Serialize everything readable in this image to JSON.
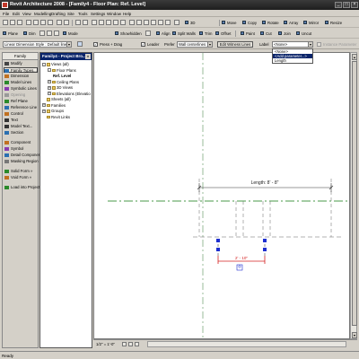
{
  "window": {
    "title": "Revit Architecture 2008 - [Family4 - Floor Plan: Ref. Level]",
    "controls": [
      "_",
      "□",
      "×"
    ]
  },
  "menu": [
    "File",
    "Edit",
    "View",
    "Modelling",
    "Drafting",
    "Site",
    "Tools",
    "Settings",
    "Window",
    "Help"
  ],
  "toolbar_top": {
    "right": [
      "Move",
      "Copy",
      "Rotate",
      "Array",
      "Mirror",
      "Resize"
    ],
    "view_3d": "3D"
  },
  "toolbar_second": {
    "left": [
      "Plane",
      "Dim"
    ],
    "mid": [
      "Mode",
      "Showhidden",
      "Align",
      "Split Walls",
      "Trim",
      "Offset"
    ],
    "right": [
      "Paint",
      "Cut",
      "Join",
      "Uncut"
    ]
  },
  "options_bar": {
    "dimension_style": "Linear Dimension Style : Default linea",
    "prefer_label": "Prefer",
    "prefer_value": "Wall centerlines",
    "press_drag": "Press + Drag",
    "leader": "Leader",
    "edit_witness_lines": "Edit Witness Lines",
    "label_label": "Label",
    "label_value": "<None>",
    "instance_parameter": "Instance Parameter",
    "label_options": [
      "<None>",
      "<Add parameter...>",
      "Length"
    ],
    "label_selected_index": 1
  },
  "design_bar": {
    "tab": "Family",
    "items": [
      {
        "label": "Modify",
        "icon": "arrow-icon",
        "active": false,
        "disabled": false
      },
      {
        "label": "Family Types...",
        "icon": "family-types-icon",
        "active": true,
        "disabled": false
      },
      {
        "label": "Dimension",
        "icon": "dimension-icon",
        "active": false,
        "disabled": false
      },
      {
        "label": "Model Lines",
        "icon": "model-lines-icon",
        "active": false,
        "disabled": false
      },
      {
        "label": "Symbolic Lines",
        "icon": "symbolic-lines-icon",
        "active": false,
        "disabled": false
      },
      {
        "label": "Opening",
        "icon": "opening-icon",
        "active": false,
        "disabled": true
      },
      {
        "label": "Ref Plane",
        "icon": "ref-plane-icon",
        "active": false,
        "disabled": false
      },
      {
        "label": "Reference Line",
        "icon": "reference-line-icon",
        "active": false,
        "disabled": false
      },
      {
        "label": "Control",
        "icon": "control-icon",
        "active": false,
        "disabled": false
      },
      {
        "label": "Text",
        "icon": "text-icon",
        "active": false,
        "disabled": false
      },
      {
        "label": "Model Text...",
        "icon": "model-text-icon",
        "active": false,
        "disabled": false
      },
      {
        "label": "Section",
        "icon": "section-icon",
        "active": false,
        "disabled": false
      },
      {
        "label": "Component",
        "icon": "component-icon",
        "active": false,
        "disabled": false
      },
      {
        "label": "Symbol",
        "icon": "symbol-icon",
        "active": false,
        "disabled": false
      },
      {
        "label": "Detail Component",
        "icon": "detail-component-icon",
        "active": false,
        "disabled": false
      },
      {
        "label": "Masking Region",
        "icon": "masking-region-icon",
        "active": false,
        "disabled": false
      },
      {
        "label": "Solid Form »",
        "icon": "solid-form-icon",
        "active": false,
        "disabled": false
      },
      {
        "label": "Void Form »",
        "icon": "void-form-icon",
        "active": false,
        "disabled": false
      },
      {
        "label": "Load into Projects",
        "icon": "load-into-projects-icon",
        "active": false,
        "disabled": false
      }
    ]
  },
  "project_browser": {
    "title": "Family4 - Project Bro...",
    "nodes": [
      {
        "label": "Views (all)",
        "depth": 0,
        "toggle": "-",
        "bold": false
      },
      {
        "label": "Floor Plans",
        "depth": 1,
        "toggle": "-",
        "bold": false
      },
      {
        "label": "Ref. Level",
        "depth": 2,
        "toggle": "",
        "bold": true
      },
      {
        "label": "Ceiling Plans",
        "depth": 1,
        "toggle": "+",
        "bold": false
      },
      {
        "label": "3D Views",
        "depth": 1,
        "toggle": "+",
        "bold": false
      },
      {
        "label": "Elevations (Elevatio",
        "depth": 1,
        "toggle": "+",
        "bold": false
      },
      {
        "label": "Sheets (all)",
        "depth": 0,
        "toggle": "",
        "bold": false
      },
      {
        "label": "Families",
        "depth": 0,
        "toggle": "+",
        "bold": false
      },
      {
        "label": "Groups",
        "depth": 0,
        "toggle": "+",
        "bold": false
      },
      {
        "label": "Revit Links",
        "depth": 0,
        "toggle": "",
        "bold": false
      }
    ]
  },
  "drawing": {
    "length_dimension": "Length: 8' - 8\"",
    "small_dimension": "2' - 10\"",
    "colors": {
      "reference_plane": "#4a9a4a",
      "dimension": "#333333",
      "selected": "#d42020",
      "grip": "#1e2fd0"
    }
  },
  "view_control_bar": {
    "scale": "1/2\" = 1'-0\""
  },
  "status": {
    "text": "Ready"
  }
}
